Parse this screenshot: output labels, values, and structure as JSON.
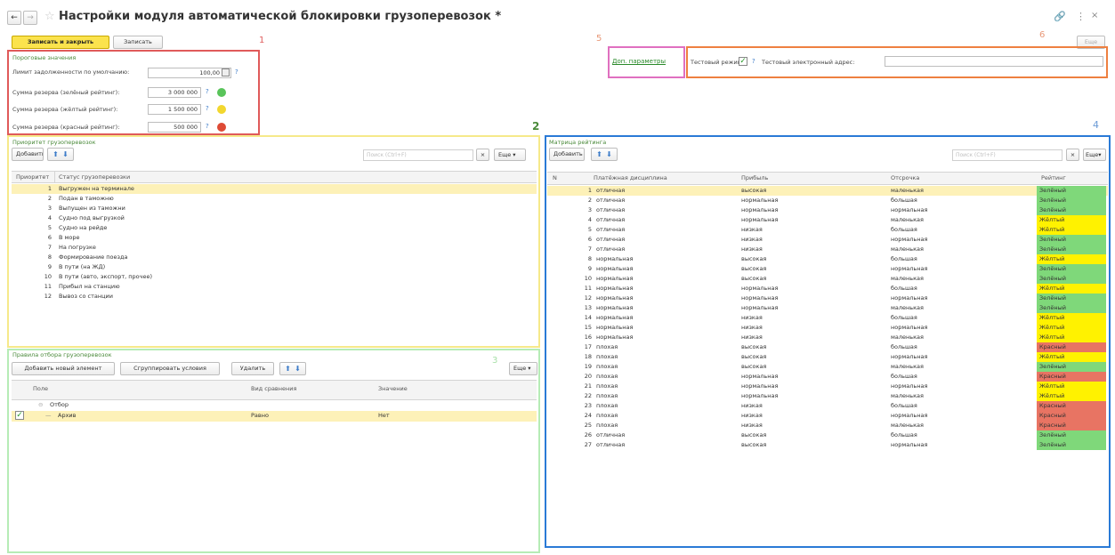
{
  "window": {
    "title": "Настройки модуля автоматической блокировки грузоперевозок *",
    "more_label": "Еще"
  },
  "toolbar": {
    "save_close_label": "Записать и закрыть",
    "save_label": "Записать"
  },
  "annotations": {
    "n1": "1",
    "n2": "2",
    "n3": "3",
    "n4": "4",
    "n5": "5",
    "n6": "6"
  },
  "thresholds": {
    "title": "Пороговые значения",
    "rows": [
      {
        "label": "Лимит задолженности по умолчанию:",
        "value": "100,00"
      },
      {
        "label": "Сумма резерва (зелёный рейтинг):",
        "value": "3 000 000"
      },
      {
        "label": "Сумма резерва (жёлтый рейтинг):",
        "value": "1 500 000"
      },
      {
        "label": "Сумма резерва (красный рейтинг):",
        "value": "500 000"
      }
    ],
    "colors": {
      "green": "#59c45a",
      "yellow": "#f2d72f",
      "red": "#de4a35"
    }
  },
  "params": {
    "link_label": "Доп. параметры",
    "test_mode_label": "Тестовый режим:",
    "test_mode_checked": true,
    "test_email_label": "Тестовый электронный адрес:",
    "test_email_value": ""
  },
  "priority": {
    "title": "Приоритет грузоперевозок",
    "add_label": "Добавить",
    "search_placeholder": "Поиск (Ctrl+F)",
    "more_label": "Еще",
    "columns": [
      "Приоритет",
      "Статус грузоперевозки"
    ],
    "rows": [
      {
        "n": "1",
        "status": "Выгружен на терминале"
      },
      {
        "n": "2",
        "status": "Подан в таможню"
      },
      {
        "n": "3",
        "status": "Выпущен из таможни"
      },
      {
        "n": "4",
        "status": "Судно под выгрузкой"
      },
      {
        "n": "5",
        "status": "Судно на рейде"
      },
      {
        "n": "6",
        "status": "В море"
      },
      {
        "n": "7",
        "status": "На погрузке"
      },
      {
        "n": "8",
        "status": "Формирование поезда"
      },
      {
        "n": "9",
        "status": "В пути (на ЖД)"
      },
      {
        "n": "10",
        "status": "В пути (авто, экспорт, прочее)"
      },
      {
        "n": "11",
        "status": "Прибыл на станцию"
      },
      {
        "n": "12",
        "status": "Вывоз со станции"
      }
    ]
  },
  "filter": {
    "title": "Правила отбора грузоперевозок",
    "add_label": "Добавить новый элемент",
    "group_label": "Сгруппировать условия",
    "delete_label": "Удалить",
    "more_label": "Еще",
    "columns": [
      "Поле",
      "Вид сравнения",
      "Значение"
    ],
    "group_row": "Отбор",
    "item_field": "Архив",
    "item_compare": "Равно",
    "item_value": "Нет"
  },
  "matrix": {
    "title": "Матрица рейтинга",
    "add_label": "Добавить",
    "search_placeholder": "Поиск (Ctrl+F)",
    "more_label": "Еще",
    "columns": [
      "N",
      "Платёжная дисциплина",
      "Прибыль",
      "Отсрочка",
      "Рейтинг"
    ],
    "rating_colors": {
      "Зелёный": "#7fd87a",
      "Жёлтый": "#fff200",
      "Красный": "#e87463"
    },
    "rows": [
      {
        "n": "1",
        "d": "отличная",
        "p": "высокая",
        "o": "маленькая",
        "r": "Зелёный"
      },
      {
        "n": "2",
        "d": "отличная",
        "p": "нормальная",
        "o": "большая",
        "r": "Зелёный"
      },
      {
        "n": "3",
        "d": "отличная",
        "p": "нормальная",
        "o": "нормальная",
        "r": "Зелёный"
      },
      {
        "n": "4",
        "d": "отличная",
        "p": "нормальная",
        "o": "маленькая",
        "r": "Жёлтый"
      },
      {
        "n": "5",
        "d": "отличная",
        "p": "низкая",
        "o": "большая",
        "r": "Жёлтый"
      },
      {
        "n": "6",
        "d": "отличная",
        "p": "низкая",
        "o": "нормальная",
        "r": "Зелёный"
      },
      {
        "n": "7",
        "d": "отличная",
        "p": "низкая",
        "o": "маленькая",
        "r": "Зелёный"
      },
      {
        "n": "8",
        "d": "нормальная",
        "p": "высокая",
        "o": "большая",
        "r": "Жёлтый"
      },
      {
        "n": "9",
        "d": "нормальная",
        "p": "высокая",
        "o": "нормальная",
        "r": "Зелёный"
      },
      {
        "n": "10",
        "d": "нормальная",
        "p": "высокая",
        "o": "маленькая",
        "r": "Зелёный"
      },
      {
        "n": "11",
        "d": "нормальная",
        "p": "нормальная",
        "o": "большая",
        "r": "Жёлтый"
      },
      {
        "n": "12",
        "d": "нормальная",
        "p": "нормальная",
        "o": "нормальная",
        "r": "Зелёный"
      },
      {
        "n": "13",
        "d": "нормальная",
        "p": "нормальная",
        "o": "маленькая",
        "r": "Зелёный"
      },
      {
        "n": "14",
        "d": "нормальная",
        "p": "низкая",
        "o": "большая",
        "r": "Жёлтый"
      },
      {
        "n": "15",
        "d": "нормальная",
        "p": "низкая",
        "o": "нормальная",
        "r": "Жёлтый"
      },
      {
        "n": "16",
        "d": "нормальная",
        "p": "низкая",
        "o": "маленькая",
        "r": "Жёлтый"
      },
      {
        "n": "17",
        "d": "плохая",
        "p": "высокая",
        "o": "большая",
        "r": "Красный"
      },
      {
        "n": "18",
        "d": "плохая",
        "p": "высокая",
        "o": "нормальная",
        "r": "Жёлтый"
      },
      {
        "n": "19",
        "d": "плохая",
        "p": "высокая",
        "o": "маленькая",
        "r": "Зелёный"
      },
      {
        "n": "20",
        "d": "плохая",
        "p": "нормальная",
        "o": "большая",
        "r": "Красный"
      },
      {
        "n": "21",
        "d": "плохая",
        "p": "нормальная",
        "o": "нормальная",
        "r": "Жёлтый"
      },
      {
        "n": "22",
        "d": "плохая",
        "p": "нормальная",
        "o": "маленькая",
        "r": "Жёлтый"
      },
      {
        "n": "23",
        "d": "плохая",
        "p": "низкая",
        "o": "большая",
        "r": "Красный"
      },
      {
        "n": "24",
        "d": "плохая",
        "p": "низкая",
        "o": "нормальная",
        "r": "Красный"
      },
      {
        "n": "25",
        "d": "плохая",
        "p": "низкая",
        "o": "маленькая",
        "r": "Красный"
      },
      {
        "n": "26",
        "d": "отличная",
        "p": "высокая",
        "o": "большая",
        "r": "Зелёный"
      },
      {
        "n": "27",
        "d": "отличная",
        "p": "высокая",
        "o": "нормальная",
        "r": "Зелёный"
      }
    ]
  }
}
